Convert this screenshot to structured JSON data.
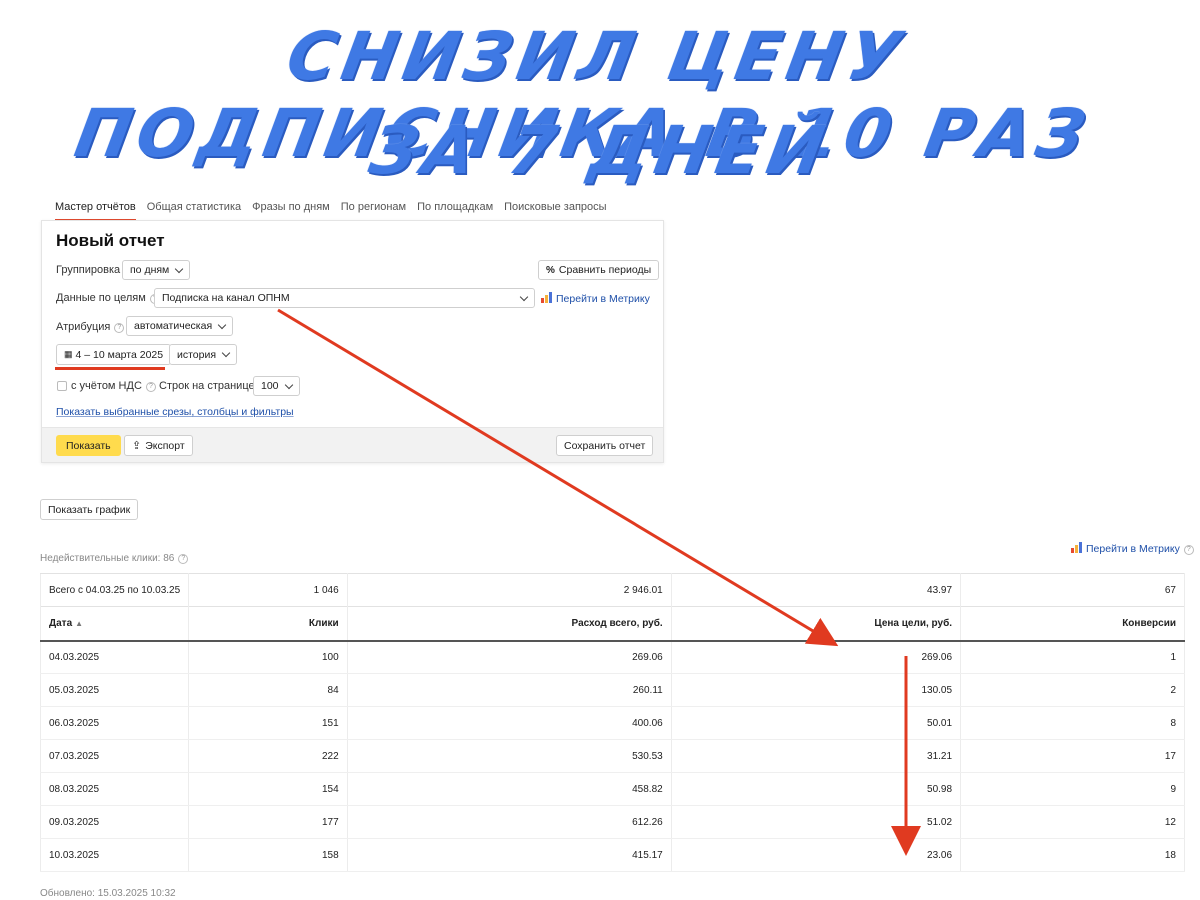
{
  "headline": {
    "line1": "СНИЗИЛ ЦЕНУ ПОДПИСЧИКА В 10 РАЗ",
    "line2": "ЗА 7 ДНЕЙ"
  },
  "tabs": [
    {
      "label": "Мастер отчётов",
      "active": true
    },
    {
      "label": "Общая статистика",
      "active": false
    },
    {
      "label": "Фразы по дням",
      "active": false
    },
    {
      "label": "По регионам",
      "active": false
    },
    {
      "label": "По площадкам",
      "active": false
    },
    {
      "label": "Поисковые запросы",
      "active": false
    }
  ],
  "report": {
    "title": "Новый отчет",
    "grouping_label": "Группировка",
    "grouping_value": "по дням",
    "compare_button": "Сравнить периоды",
    "goals_label": "Данные по целям",
    "goals_value": "Подписка на канал ОПНМ",
    "metrika_link": "Перейти в Метрику",
    "attribution_label": "Атрибуция",
    "attribution_value": "автоматическая",
    "date_range": "4 – 10 марта 2025",
    "history_value": "история",
    "vat_label": "с учётом НДС",
    "rows_label": "Строк на странице",
    "rows_value": "100",
    "show_slices_link": "Показать выбранные срезы, столбцы и фильтры",
    "show_button": "Показать",
    "export_button": "Экспорт",
    "save_button": "Сохранить отчет"
  },
  "show_graph_button": "Показать график",
  "invalid_clicks": "Недействительные клики: 86",
  "metrika_link_2": "Перейти в Метрику",
  "table": {
    "total": [
      "Всего с 04.03.25 по 10.03.25",
      "1 046",
      "2 946.01",
      "43.97",
      "67"
    ],
    "headers": [
      "Дата",
      "Клики",
      "Расход всего, руб.",
      "Цена цели, руб.",
      "Конверсии"
    ],
    "sort_indicator": "▲",
    "rows": [
      [
        "04.03.2025",
        "100",
        "269.06",
        "269.06",
        "1"
      ],
      [
        "05.03.2025",
        "84",
        "260.11",
        "130.05",
        "2"
      ],
      [
        "06.03.2025",
        "151",
        "400.06",
        "50.01",
        "8"
      ],
      [
        "07.03.2025",
        "222",
        "530.53",
        "31.21",
        "17"
      ],
      [
        "08.03.2025",
        "154",
        "458.82",
        "50.98",
        "9"
      ],
      [
        "09.03.2025",
        "177",
        "612.26",
        "51.02",
        "12"
      ],
      [
        "10.03.2025",
        "158",
        "415.17",
        "23.06",
        "18"
      ]
    ]
  },
  "updated": "Обновлено: 15.03.2025 10:32",
  "colors": {
    "headline": "#3f79e4",
    "accent_red": "#e03a20",
    "button_yellow": "#ffdb4d",
    "link": "#1e4fa8"
  }
}
